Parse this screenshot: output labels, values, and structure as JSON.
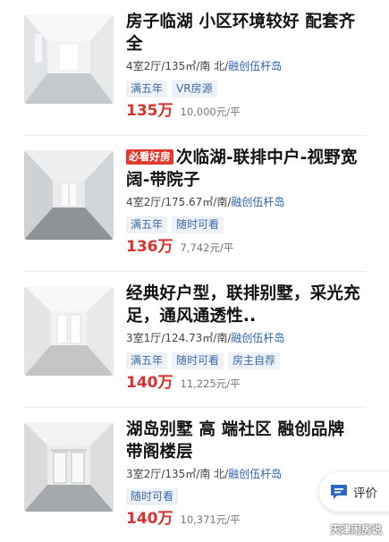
{
  "listings": [
    {
      "title": "房子临湖 小区环境较好 配套齐全",
      "badge": "",
      "layout_info": "4室2厅/135㎡/南 北/",
      "community": "融创伍杆岛",
      "tags": [
        "满五年",
        "VR房源"
      ],
      "price": "135万",
      "unit_price": "10,000元/平"
    },
    {
      "title": "次临湖-联排中户-视野宽阔-带院子",
      "badge": "必看好房",
      "layout_info": "4室2厅/175.67㎡/南/",
      "community": "融创伍杆岛",
      "tags": [
        "满五年",
        "随时可看"
      ],
      "price": "136万",
      "unit_price": "7,742元/平"
    },
    {
      "title": "经典好户型，联排别墅，采光充足，通风通透性..",
      "badge": "",
      "layout_info": "3室1厅/124.73㎡/南/",
      "community": "融创伍杆岛",
      "tags": [
        "满五年",
        "随时可看",
        "房主自荐"
      ],
      "price": "140万",
      "unit_price": "11,225元/平"
    },
    {
      "title": "湖岛别墅 高 端社区 融创品牌 带阁楼层",
      "badge": "",
      "layout_info": "3室2厅/135㎡/南 北/",
      "community": "融创伍杆岛",
      "tags": [
        "随时可看"
      ],
      "price": "140万",
      "unit_price": "10,371元/平"
    }
  ],
  "review_button": {
    "label": "评价",
    "icon": "chat-bubble-icon"
  },
  "watermark": "天津闹房说",
  "colors": {
    "price": "#d9312b",
    "community": "#2a62b4",
    "tag_text": "#3d6aa8",
    "tag_bg": "#eef2f8",
    "badge_bg": "#e03a2f"
  }
}
